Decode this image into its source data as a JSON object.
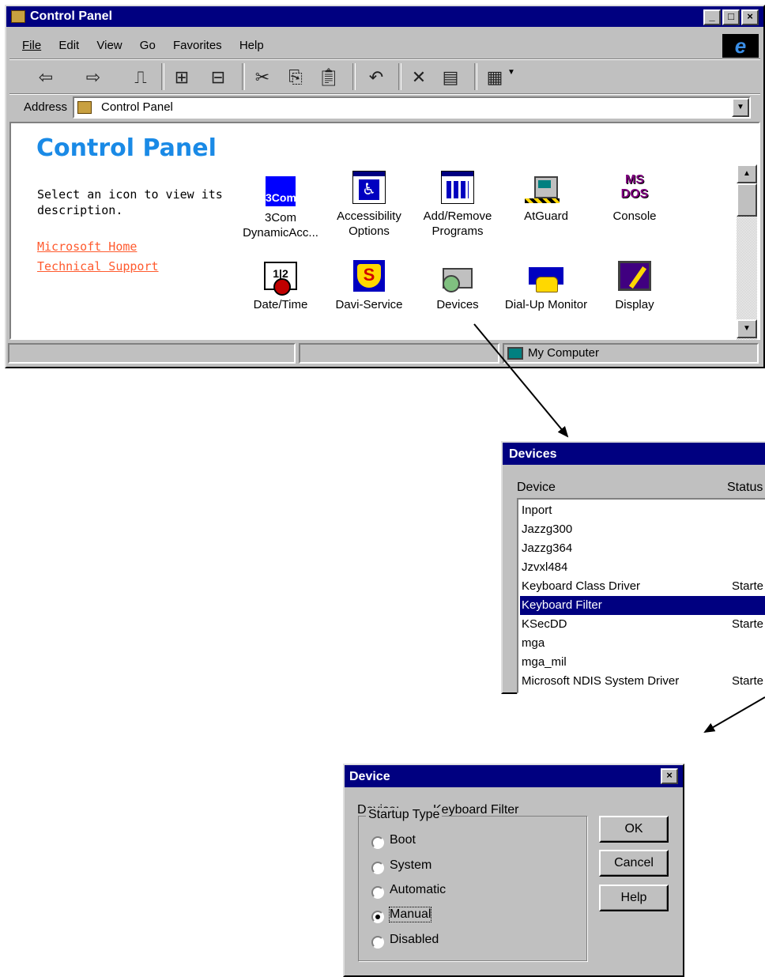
{
  "cp_window": {
    "title": "Control Panel",
    "menu": [
      "File",
      "Edit",
      "View",
      "Go",
      "Favorites",
      "Help"
    ],
    "address_label": "Address",
    "address_value": "Control Panel",
    "heading": "Control Panel",
    "description": "Select an icon to view its description.",
    "links": [
      "Microsoft Home",
      "Technical Support"
    ],
    "icons": [
      {
        "label": "3Com DynamicAcc...",
        "icon": "3com-icon"
      },
      {
        "label": "Accessibility Options",
        "icon": "accessibility-icon"
      },
      {
        "label": "Add/Remove Programs",
        "icon": "add-remove-programs-icon"
      },
      {
        "label": "AtGuard",
        "icon": "atguard-icon"
      },
      {
        "label": "Console",
        "icon": "ms-dos-console-icon"
      },
      {
        "label": "Date/Time",
        "icon": "calendar-clock-icon"
      },
      {
        "label": "Davi-Service",
        "icon": "superman-shield-icon"
      },
      {
        "label": "Devices",
        "icon": "devices-icon"
      },
      {
        "label": "Dial-Up Monitor",
        "icon": "dialup-monitor-icon"
      },
      {
        "label": "Display",
        "icon": "display-icon"
      }
    ],
    "icon_text_3com": "3Com",
    "icon_text_console": "MS DOS",
    "icon_text_datetime": "1|2",
    "status_zone": "My Computer"
  },
  "devices_window": {
    "title": "Devices",
    "col_device": "Device",
    "col_status": "Status",
    "rows": [
      {
        "name": "Inport",
        "status": ""
      },
      {
        "name": "Jazzg300",
        "status": ""
      },
      {
        "name": "Jazzg364",
        "status": ""
      },
      {
        "name": "Jzvxl484",
        "status": ""
      },
      {
        "name": "Keyboard Class Driver",
        "status": "Starte"
      },
      {
        "name": "Keyboard Filter",
        "status": "",
        "selected": true
      },
      {
        "name": "KSecDD",
        "status": "Starte"
      },
      {
        "name": "mga",
        "status": ""
      },
      {
        "name": "mga_mil",
        "status": ""
      },
      {
        "name": "Microsoft NDIS System Driver",
        "status": "Starte"
      }
    ]
  },
  "device_dialog": {
    "title": "Device",
    "device_label": "Device:",
    "device_value": "Keyboard Filter",
    "group_label": "Startup Type",
    "options": [
      "Boot",
      "System",
      "Automatic",
      "Manual",
      "Disabled"
    ],
    "selected_option": "Manual",
    "buttons": [
      "OK",
      "Cancel",
      "Help"
    ]
  },
  "colors": {
    "titlebar": "#000080",
    "link": "#ff5a2e",
    "heading": "#1a8ae6",
    "face": "#c0c0c0"
  }
}
